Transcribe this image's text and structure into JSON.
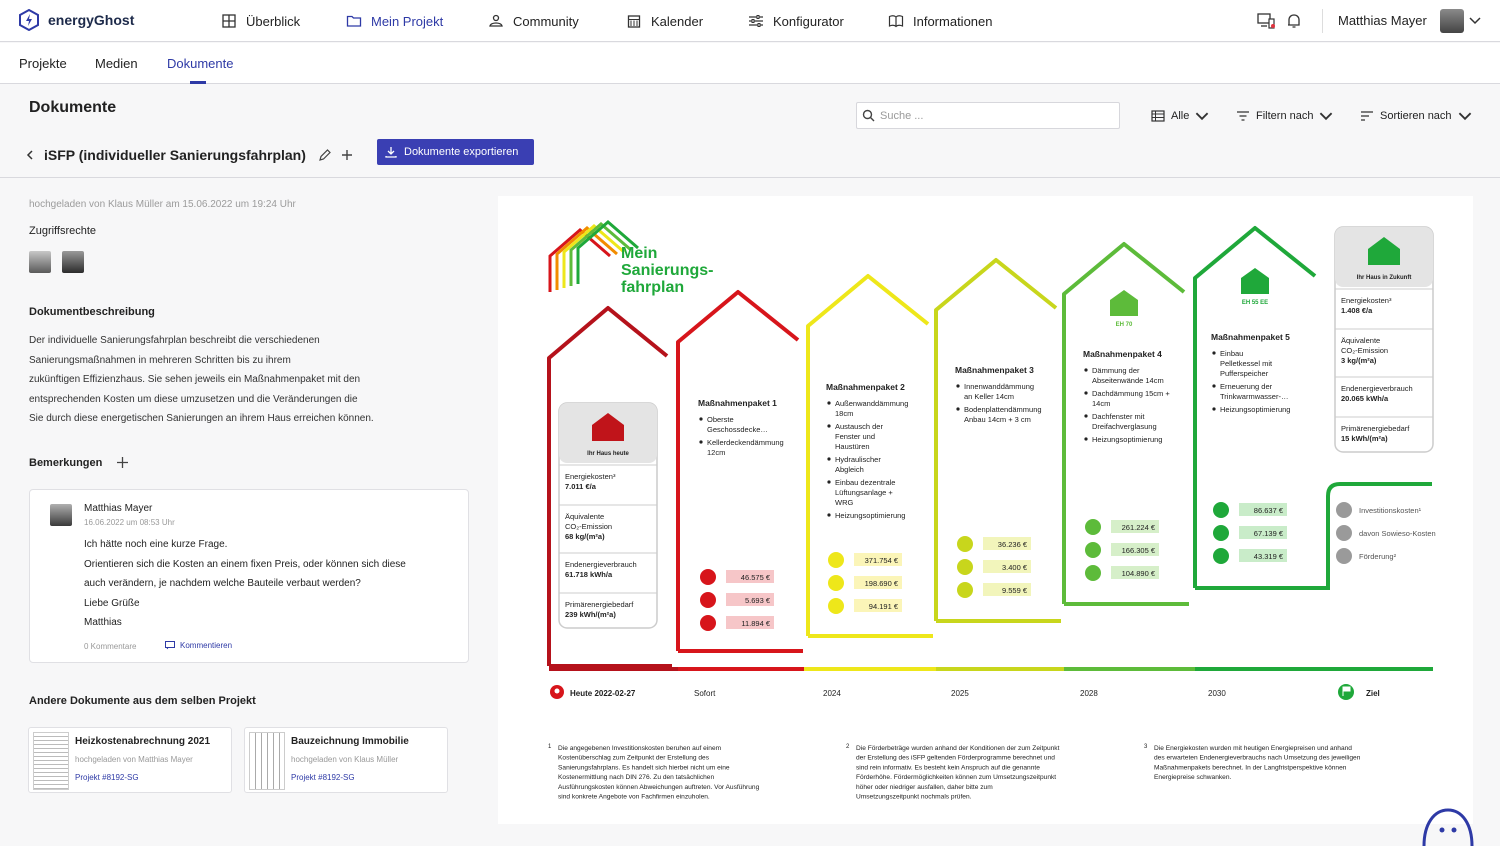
{
  "app": {
    "name": "energyGhost"
  },
  "nav": {
    "items": [
      {
        "label": "Überblick",
        "icon": "grid-icon"
      },
      {
        "label": "Mein Projekt",
        "icon": "folder-icon"
      },
      {
        "label": "Community",
        "icon": "community-icon"
      },
      {
        "label": "Kalender",
        "icon": "calendar-icon"
      },
      {
        "label": "Konfigurator",
        "icon": "sliders-icon"
      },
      {
        "label": "Informationen",
        "icon": "book-icon"
      }
    ],
    "user": "Matthias Mayer"
  },
  "subnav": {
    "tabs": [
      "Projekte",
      "Medien",
      "Dokumente"
    ],
    "active": "Dokumente"
  },
  "header": {
    "title": "Dokumente",
    "search_placeholder": "Suche ...",
    "view_label": "Alle",
    "filter_label": "Filtern nach",
    "sort_label": "Sortieren nach",
    "doc_title": "iSFP (individueller Sanierungsfahrplan)",
    "export_label": "Dokumente exportieren"
  },
  "left": {
    "meta": "hochgeladen von Klaus Müller am 15.06.2022 um 19:24 Uhr",
    "access_label": "Zugriffsrechte",
    "desc_head": "Dokumentbeschreibung",
    "desc_lines": [
      "Der individuelle Sanierungsfahrplan beschreibt die verschiedenen",
      "Sanierungsmaßnahmen in mehreren Schritten bis zu ihrem",
      "zukünftigen Effizienzhaus. Sie sehen jeweils ein Maßnahmenpaket mit den",
      "entsprechenden Kosten um diese umzusetzen und die Veränderungen die",
      "Sie durch diese energetischen Sanierungen an ihrem Haus erreichen können."
    ],
    "remarks_head": "Bemerkungen",
    "comment": {
      "name": "Matthias Mayer",
      "date": "16.06.2022 um 08:53 Uhr",
      "lines": [
        "Ich hätte noch eine kurze Frage.",
        "Orientieren sich die Kosten an einem fixen Preis, oder können sich diese",
        "auch verändern, je nachdem welche Bauteile verbaut werden?",
        "Liebe Grüße",
        "Matthias"
      ],
      "count": "0 Kommentare",
      "reply": "Kommentieren"
    },
    "other_head": "Andere Dokumente aus dem selben Projekt",
    "other_docs": [
      {
        "title": "Heizkostenabrechnung 2021",
        "uploader": "hochgeladen von Matthias Mayer",
        "project": "Projekt #8192-SG"
      },
      {
        "title": "Bauzeichnung Immobilie",
        "uploader": "hochgeladen von Klaus Müller",
        "project": "Projekt #8192-SG"
      }
    ]
  },
  "plan": {
    "logo_lines": [
      "Mein",
      "Sanierungs-",
      "fahrplan"
    ],
    "today_house": {
      "label": "Ihr Haus heute",
      "rows": [
        [
          "Energiekosten³",
          "7.011 €/a"
        ],
        [
          "Äquivalente",
          "CO₂-Emission",
          "68 kg/(m²a)"
        ],
        [
          "Endenergieverbrauch",
          "61.718 kWh/a"
        ],
        [
          "Primärenergiebedarf",
          "239 kWh/(m²a)"
        ]
      ]
    },
    "packages": [
      {
        "title": "Maßnahmenpaket 1",
        "items": [
          "Oberste Geschossdecke…",
          "Kellerdeckendämmung 12cm"
        ],
        "costs": [
          "46.575 €",
          "5.693 €",
          "11.894 €"
        ],
        "color": "#d7151b",
        "badge": ""
      },
      {
        "title": "Maßnahmenpaket 2",
        "items": [
          "Außenwanddämmung 18cm",
          "Austausch der Fenster und Haustüren",
          "Hydraulischer Abgleich",
          "Einbau dezentrale Lüftungsanlage + WRG",
          "Heizungsoptimierung"
        ],
        "costs": [
          "371.754 €",
          "198.690 €",
          "94.191 €"
        ],
        "color": "#eee71a",
        "badge": ""
      },
      {
        "title": "Maßnahmenpaket 3",
        "items": [
          "Innenwanddämmung an Keller 14cm",
          "Bodenplattendämmung Anbau 14cm + 3 cm"
        ],
        "costs": [
          "36.236 €",
          "3.400 €",
          "9.559 €"
        ],
        "color": "#c8d61c",
        "badge": ""
      },
      {
        "title": "Maßnahmenpaket 4",
        "items": [
          "Dämmung der Abseitenwände 14cm",
          "Dachdämmung 15cm + 14cm",
          "Dachfenster mit Dreifachverglasung",
          "Heizungsoptimierung"
        ],
        "costs": [
          "261.224 €",
          "166.305 €",
          "104.890 €"
        ],
        "color": "#5dbb3a",
        "badge": "EH 70"
      },
      {
        "title": "Maßnahmenpaket 5",
        "items": [
          "Einbau Pelletkessel mit Pufferspeicher",
          "Erneuerung der Trinkwarmwasser-…",
          "Heizungsoptimierung"
        ],
        "costs": [
          "86.637 €",
          "67.139 €",
          "43.319 €"
        ],
        "color": "#1fa83a",
        "badge": "EH 55 EE"
      }
    ],
    "future_house": {
      "label": "Ihr Haus in Zukunft",
      "rows": [
        [
          "Energiekosten³",
          "1.408 €/a"
        ],
        [
          "Äquivalente",
          "CO₂-Emission",
          "3 kg/(m²a)"
        ],
        [
          "Endenergieverbrauch",
          "20.065 kWh/a"
        ],
        [
          "Primärenergiebedarf",
          "15 kWh/(m²a)"
        ]
      ]
    },
    "legend": [
      "Investitionskosten¹",
      "davon Sowieso-Kosten",
      "Förderung²"
    ],
    "timeline": [
      "Heute 2022-02-27",
      "Sofort",
      "2024",
      "2025",
      "2028",
      "2030",
      "Ziel"
    ],
    "footnotes": [
      {
        "n": "1",
        "text": "Die angegebenen Investitionskosten beruhen auf einem Kostenüberschlag zum Zeitpunkt der Erstellung des Sanierungsfahrplans. Es handelt sich hierbei nicht um eine Kostenermittlung nach DIN 276. Zu den tatsächlichen Ausführungskosten können Abweichungen auftreten. Vor Ausführung sind konkrete Angebote von Fachfirmen einzuholen."
      },
      {
        "n": "2",
        "text": "Die Förderbeträge wurden anhand der Konditionen der zum Zeitpunkt der Erstellung des iSFP geltenden Förderprogramme berechnet und sind rein informativ. Es besteht kein Anspruch auf die genannte Förderhöhe. Fördermöglichkeiten können zum Umsetzungszeitpunkt höher oder niedriger ausfallen, daher bitte zum Umsetzungszeitpunkt nochmals prüfen."
      },
      {
        "n": "3",
        "text": "Die Energiekosten wurden mit heutigen Energiepreisen und anhand des erwarteten Endenergieverbrauchs nach Umsetzung des jeweiligen Maßnahmenpakets berechnet. In der Langfristperspektive können Energiepreise schwanken."
      }
    ]
  }
}
